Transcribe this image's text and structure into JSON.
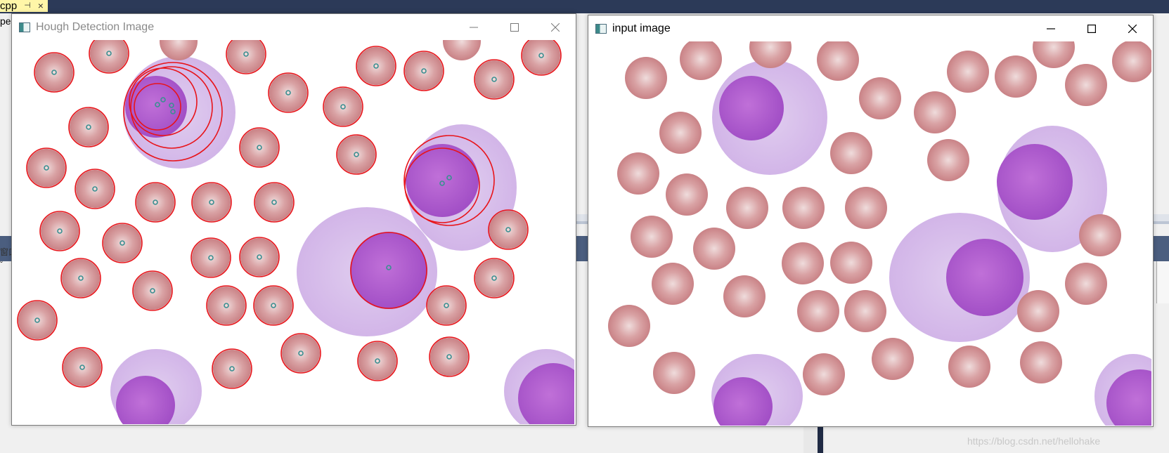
{
  "ide": {
    "tab_label": "cpp",
    "tab_pin": "⊣",
    "tab_close": "×",
    "left_fragment": "per",
    "left_fragments_lower": [
      "窗口",
      "ˇ"
    ],
    "watermark": "https://blog.csdn.net/hellohake"
  },
  "windows": [
    {
      "title": "Hough Detection Image",
      "controls": [
        "minimize",
        "maximize",
        "close"
      ]
    },
    {
      "title": "input image",
      "controls": [
        "minimize",
        "maximize",
        "close"
      ]
    }
  ],
  "colors": {
    "circle": "#e8141a",
    "center": "#3a8f91",
    "rbc_dark": "#c98286",
    "rbc_light": "#efdcdc",
    "wbc_cyto": "#d2b5e8",
    "wbc_nucleus": "#a24fc6",
    "title_bar_bg": "#ffffff",
    "ide_dark": "#2c3a58",
    "ide_tab": "#fff6a8"
  },
  "icons": {
    "app": "opencv-window-icon",
    "minimize": "minimize-icon",
    "maximize": "maximize-icon",
    "close": "close-icon"
  }
}
